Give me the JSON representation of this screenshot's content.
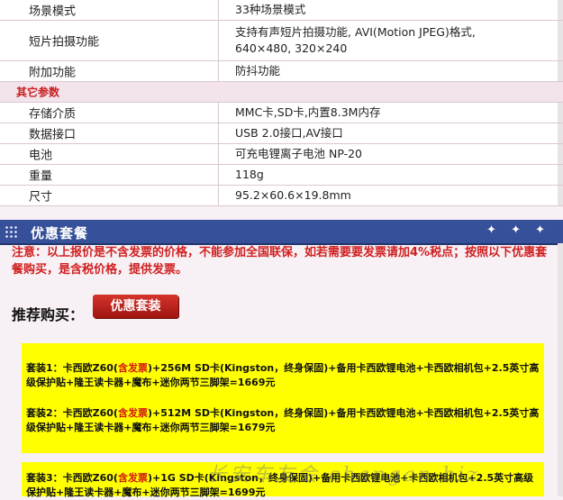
{
  "spec_rows_a": [
    {
      "key": "场景模式",
      "value": "33种场景模式"
    },
    {
      "key": "短片拍摄功能",
      "value": "支持有声短片拍摄功能, AVI(Motion JPEG)格式, 640×480, 320×240"
    },
    {
      "key": "附加功能",
      "value": "防抖功能"
    }
  ],
  "section_other": "其它参数",
  "spec_rows_b": [
    {
      "key": "存储介质",
      "value": "MMC卡,SD卡,内置8.3M内存"
    },
    {
      "key": "数据接口",
      "value": "USB 2.0接口,AV接口"
    },
    {
      "key": "电池",
      "value": "可充电锂离子电池 NP-20"
    },
    {
      "key": "重量",
      "value": "118g"
    },
    {
      "key": "尺寸",
      "value": "95.2×60.6×19.8mm"
    }
  ],
  "promo": {
    "title": "优惠套餐",
    "stars": "✦ ✦ ✦",
    "notice": "注意：以上报价是不含发票的价格，不能参加全国联保，如若需要要发票请加4%税点；按照以下优惠套餐购买，是含税价格，提供发票。",
    "recommend_label": "推荐购买：",
    "recommend_button": "优惠套装",
    "packages": [
      {
        "prefix": "套装1：卡西欧Z60(",
        "tag": "含发票",
        "rest": ")+256M SD卡(Kingston，终身保固)+备用卡西欧锂电池+卡西欧相机包+2.5英寸高级保护贴+隆王读卡器+魔布+迷你两节三脚架=1669元"
      },
      {
        "prefix": "套装2：卡西欧Z60(",
        "tag": "含发票",
        "rest": ")+512M SD卡(Kingston，终身保固)+备用卡西欧锂电池+卡西欧相机包+2.5英寸高级保护贴+隆王读卡器+魔布+迷你两节三脚架=1679元"
      },
      {
        "prefix": "套装3：卡西欧Z60(",
        "tag": "含发票",
        "rest": ")+1G SD卡(Kingston，终身保固)+备用卡西欧锂电池+卡西欧相机包+2.5英寸高级保护贴+隆王读卡器+魔布+迷你两节三脚架=1699元"
      }
    ]
  },
  "watermark": "长安车友会 changan.biz"
}
